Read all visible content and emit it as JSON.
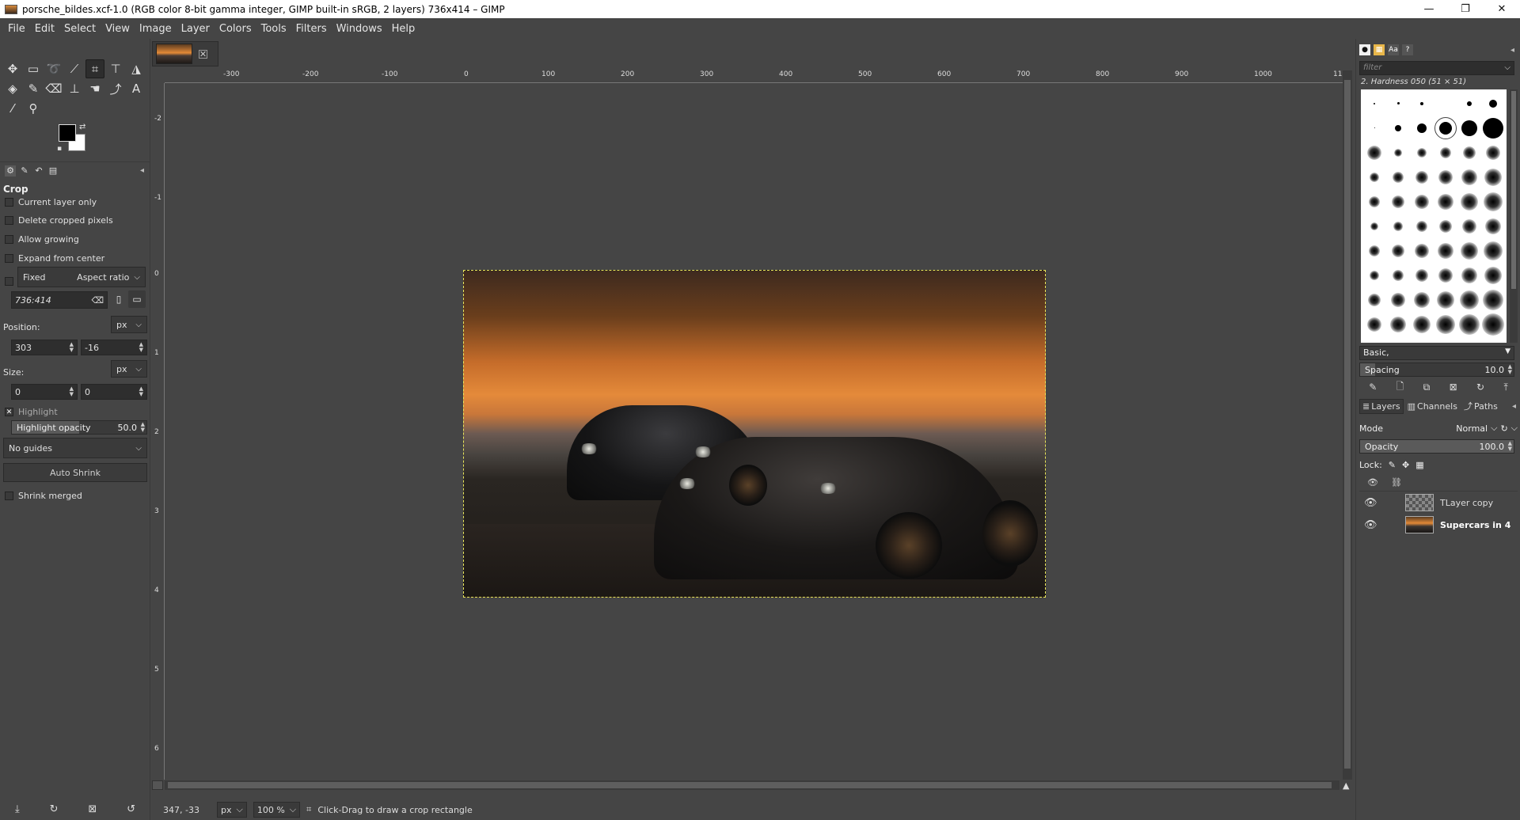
{
  "window": {
    "title": "porsche_bildes.xcf-1.0 (RGB color 8-bit gamma integer, GIMP built-in sRGB, 2 layers) 736x414 – GIMP",
    "minimize": "—",
    "maximize": "❐",
    "close": "✕"
  },
  "menubar": [
    "File",
    "Edit",
    "Select",
    "View",
    "Image",
    "Layer",
    "Colors",
    "Tools",
    "Filters",
    "Windows",
    "Help"
  ],
  "toolbox": {
    "row1_icons": [
      "move-icon",
      "rect-select-icon",
      "lasso-icon",
      "fuzzy-select-icon",
      "crop-icon",
      "transform-icon",
      "warp-icon"
    ],
    "row2_icons": [
      "bucket-fill-icon",
      "paintbrush-icon",
      "eraser-icon",
      "clone-icon",
      "smudge-icon",
      "paths-icon",
      "text-icon"
    ],
    "row3_icons": [
      "color-picker-icon",
      "zoom-icon"
    ],
    "colors": {
      "foreground": "#000000",
      "background": "#ffffff"
    }
  },
  "tool_options": {
    "title": "Crop",
    "current_layer_only": "Current layer only",
    "delete_cropped_pixels": "Delete cropped pixels",
    "allow_growing": "Allow growing",
    "expand_from_center": "Expand from center",
    "fixed_label": "Fixed",
    "fixed_mode": "Aspect ratio",
    "ratio_value": "736:414",
    "position_label": "Position:",
    "position_unit": "px",
    "position_x": "303",
    "position_y": "-16",
    "size_label": "Size:",
    "size_unit": "px",
    "size_w": "0",
    "size_h": "0",
    "highlight_label": "Highlight",
    "highlight_opacity_label": "Highlight opacity",
    "highlight_opacity_value": "50.0",
    "guides": "No guides",
    "auto_shrink": "Auto Shrink",
    "shrink_merged": "Shrink merged"
  },
  "rulers": {
    "top": [
      "-300",
      "-200",
      "-100",
      "0",
      "100",
      "200",
      "300",
      "400",
      "500",
      "600",
      "700",
      "800",
      "900",
      "1000",
      "11"
    ],
    "left": [
      "-2",
      "-1",
      "0",
      "1",
      "2",
      "3",
      "4",
      "5",
      "6"
    ]
  },
  "statusbar": {
    "coords": "347, -33",
    "unit": "px",
    "zoom": "100 %",
    "message": "Click-Drag to draw a crop rectangle"
  },
  "brushes": {
    "filter_placeholder": "filter",
    "selected_name": "2. Hardness 050 (51 × 51)",
    "set": "Basic,",
    "spacing_label": "Spacing",
    "spacing_value": "10.0"
  },
  "layers_panel": {
    "tabs": [
      "Layers",
      "Channels",
      "Paths"
    ],
    "mode_label": "Mode",
    "mode_value": "Normal",
    "opacity_label": "Opacity",
    "opacity_value": "100.0",
    "lock_label": "Lock:",
    "layers": [
      {
        "name": "TLayer copy",
        "bold": false
      },
      {
        "name": "Supercars in 4",
        "bold": true
      }
    ]
  }
}
